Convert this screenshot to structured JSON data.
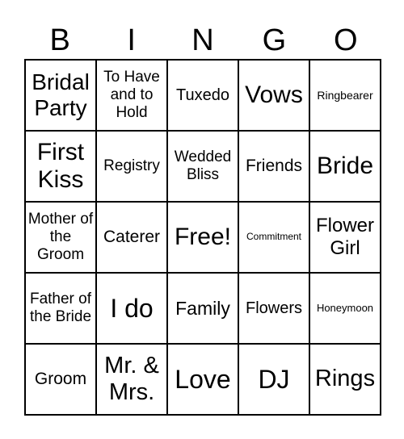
{
  "header": [
    "B",
    "I",
    "N",
    "G",
    "O"
  ],
  "cells": [
    "Bridal Party",
    "To Have and to Hold",
    "Tuxedo",
    "Vows",
    "Ringbearer",
    "First Kiss",
    "Registry",
    "Wedded Bliss",
    "Friends",
    "Bride",
    "Mother of the Groom",
    "Caterer",
    "Free!",
    "Commitment",
    "Flower Girl",
    "Father of the Bride",
    "I do",
    "Family",
    "Flowers",
    "Honeymoon",
    "Groom",
    "Mr. & Mrs.",
    "Love",
    "DJ",
    "Rings"
  ]
}
